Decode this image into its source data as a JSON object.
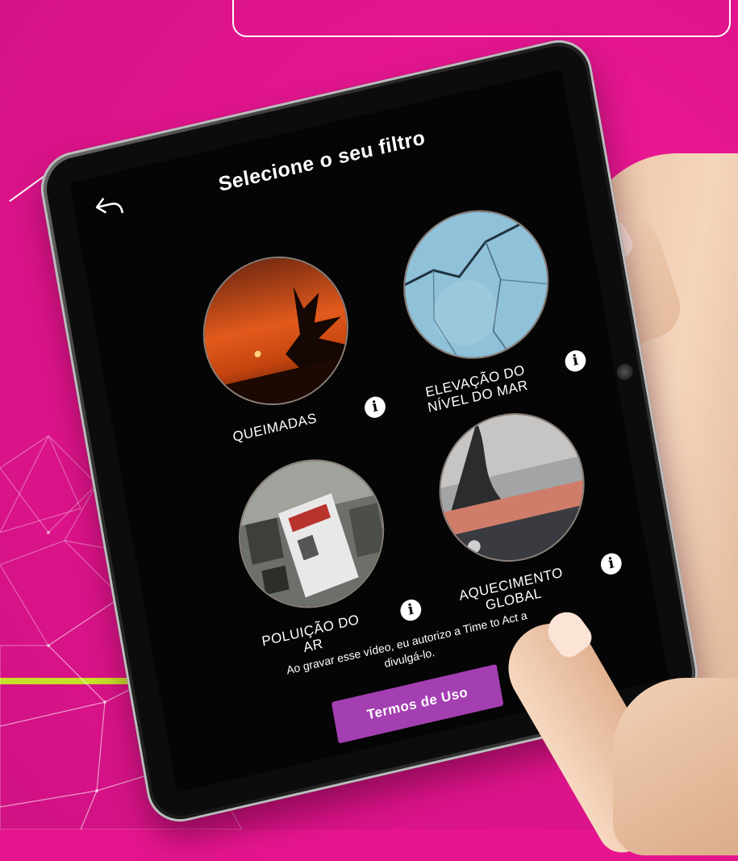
{
  "screen": {
    "title": "Selecione o seu filtro",
    "back_icon": "back-arrow-icon",
    "filters": [
      {
        "label_lines": [
          "QUEIMADAS"
        ],
        "info_icon": "info-icon"
      },
      {
        "label_lines": [
          "ELEVAÇÃO DO",
          "NÍVEL DO MAR"
        ],
        "info_icon": "info-icon"
      },
      {
        "label_lines": [
          "POLUIÇÃO DO",
          "AR"
        ],
        "info_icon": "info-icon"
      },
      {
        "label_lines": [
          "AQUECIMENTO",
          "GLOBAL"
        ],
        "info_icon": "info-icon"
      }
    ],
    "consent_lines": [
      "Ao gravar esse vídeo, eu autorizo a Time to Act a",
      "divulgá-lo."
    ],
    "terms_button": "Termos de Uso"
  },
  "colors": {
    "background": "#e6158f",
    "accent_line": "#c6e02a",
    "button": "#a43fb2",
    "screen": "#050505"
  }
}
